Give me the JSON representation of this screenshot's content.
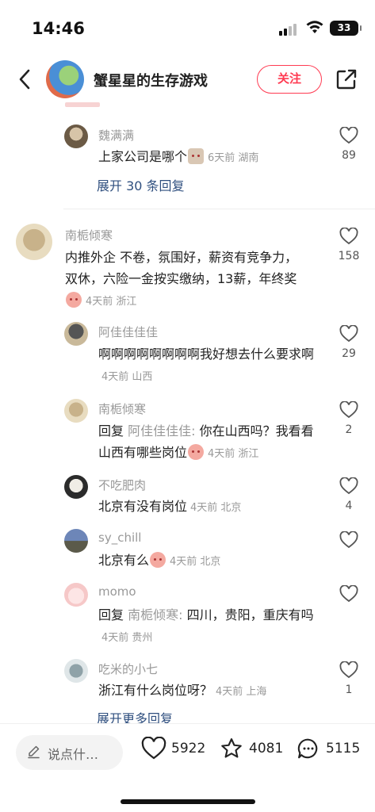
{
  "status": {
    "time": "14:46",
    "battery": "33"
  },
  "header": {
    "title": "蟹星星的生存游戏",
    "follow_label": "关注",
    "icons": [
      "back-arrow-icon",
      "share-icon"
    ],
    "accent": "#ff3b52"
  },
  "comments": [
    {
      "user": "魏满满",
      "text": "上家公司是哪个",
      "meta": "6天前 湖南",
      "likes": "89",
      "expand": "展开 30 条回复"
    },
    {
      "user": "南栀倾寒",
      "text": "内推外企 不卷，氛围好，薪资有竞争力，双休，六险一金按实缴纳，13薪，年终奖",
      "meta": "4天前 浙江",
      "likes": "158"
    },
    {
      "user": "阿佳佳佳佳",
      "text": "啊啊啊啊啊啊啊啊我好想去什么要求啊",
      "meta": "4天前 山西",
      "likes": "29"
    },
    {
      "user": "南栀倾寒",
      "reply_prefix": "回复",
      "reply_to": "阿佳佳佳佳:",
      "text": "你在山西吗？我看看山西有哪些岗位",
      "meta": "4天前 浙江",
      "likes": "2"
    },
    {
      "user": "不吃肥肉",
      "text": "北京有没有岗位",
      "meta": "4天前 北京",
      "likes": "4"
    },
    {
      "user": "sy_chill",
      "text": "北京有么",
      "meta": "4天前 北京",
      "likes": ""
    },
    {
      "user": "momo",
      "reply_prefix": "回复",
      "reply_to": "南栀倾寒:",
      "text": "四川，贵阳，重庆有吗",
      "meta": "4天前 贵州",
      "likes": ""
    },
    {
      "user": "吃米的小七",
      "text": "浙江有什么岗位呀？",
      "meta": "4天前 上海",
      "likes": "1",
      "expand": "展开更多回复"
    }
  ],
  "bottom": {
    "input_placeholder": "说点什…",
    "like_count": "5922",
    "collect_count": "4081",
    "comment_count": "5115"
  }
}
